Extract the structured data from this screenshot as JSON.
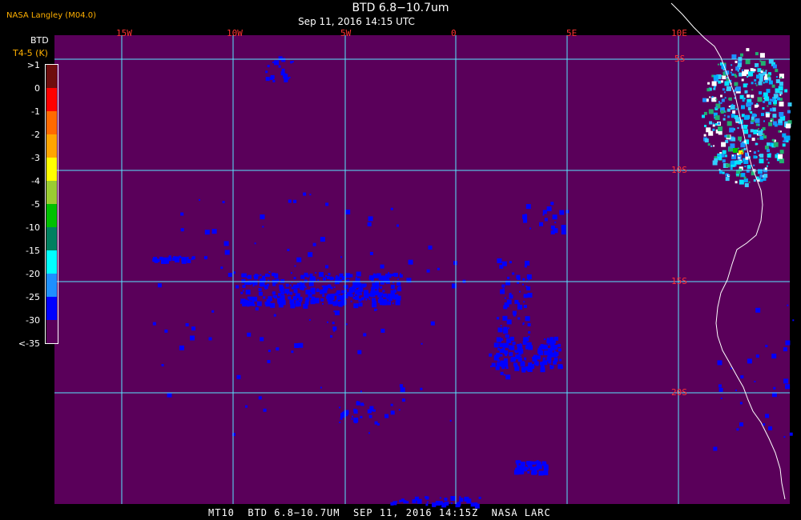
{
  "header": {
    "organization": "NASA Langley (M04.0)",
    "title": "BTD 6.8−10.7um",
    "datetime": "Sep 11, 2016 14:15 UTC"
  },
  "colorbar": {
    "title": "BTD",
    "units": "T4-5 (K)",
    "labels": [
      ">1",
      "0",
      "-1",
      "-2",
      "-3",
      "-4",
      "-5",
      "-10",
      "-15",
      "-20",
      "-25",
      "-30",
      "<-35"
    ],
    "colors": [
      "#6e0d0d",
      "#ff0000",
      "#ff6a00",
      "#ffa500",
      "#ffff00",
      "#9acd32",
      "#00c000",
      "#008060",
      "#00ffff",
      "#1e90ff",
      "#0000ff",
      "#5a005a"
    ]
  },
  "map": {
    "background_color": "#5a005a",
    "grid_color": "#58e8ff",
    "coast_color": "#ffffff",
    "cloud_color": "#0000ff",
    "longitude_labels": [
      "15W",
      "10W",
      "5W",
      "0",
      "5E",
      "10E"
    ],
    "latitude_labels": [
      "5S",
      "10S",
      "15S",
      "20S"
    ]
  },
  "footer": {
    "text": "MT10  BTD 6.8−10.7UM  SEP 11, 2016 14:15Z  NASA LARC"
  }
}
